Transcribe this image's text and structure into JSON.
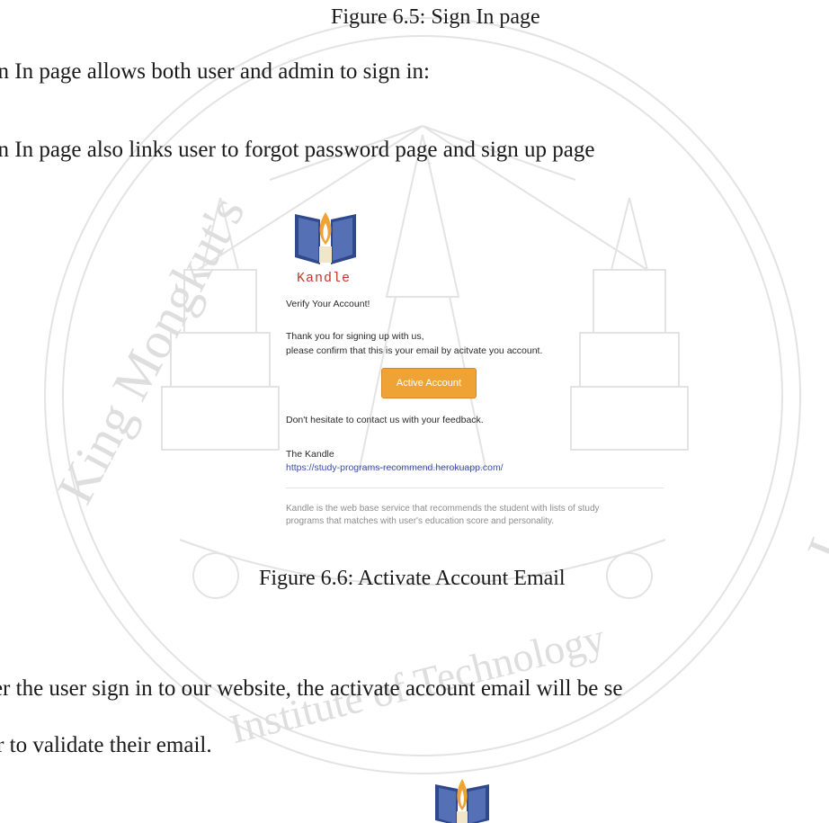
{
  "captions": {
    "figure_6_5": "Figure 6.5: Sign In page",
    "figure_6_6": "Figure 6.6: Activate Account Email"
  },
  "body_text": {
    "line1": "gn In page allows both user and admin to sign in:",
    "line2": "gn In page also links user to forgot password page and sign up page",
    "line3": "ter the user sign in to our website, the activate account email will be se",
    "line4": "er to validate their email."
  },
  "email": {
    "logo_text": "Kandle",
    "heading": "Verify Your Account!",
    "thanks": "Thank you for signing up with us,",
    "confirm": "please confirm that this is your email by acitvate you account.",
    "button_label": "Active Account",
    "hesitate": "Don't hesitate to contact us with your feedback.",
    "signature": "The Kandle",
    "link": "https://study-programs-recommend.herokuapp.com/",
    "footer_line1": "Kandle is the web base service that recommends the student with lists of study",
    "footer_line2": "programs that matches with user's education score and personality."
  },
  "watermark": {
    "text_left": "King Mongkut's",
    "text_bottom": "Institute of Technology",
    "text_right": "Ladkrabang",
    "color": "#d9d9d9"
  },
  "colors": {
    "button": "#f0a335",
    "link": "#3b4fa8",
    "logo_text": "#c0392b",
    "book_blue": "#2f4a8c",
    "flame": "#f0a335"
  }
}
